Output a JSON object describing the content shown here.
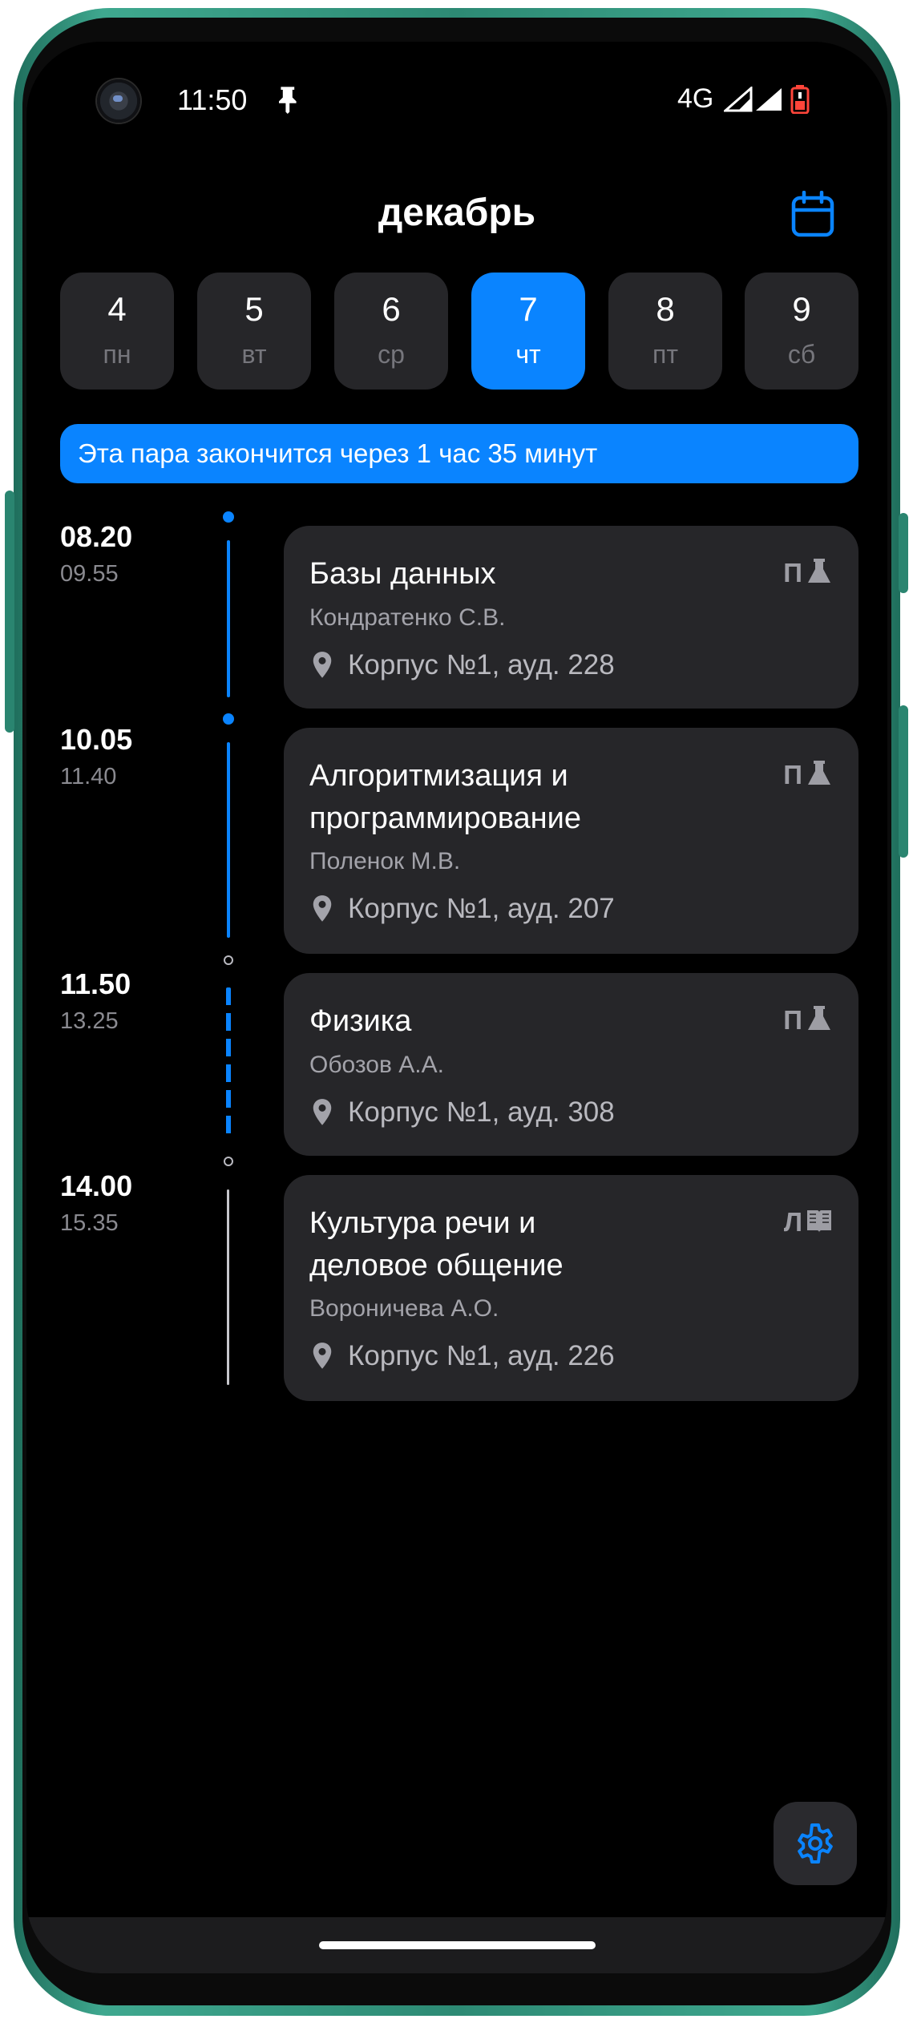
{
  "status_bar": {
    "time": "11:50",
    "network": "4G"
  },
  "header": {
    "month": "декабрь"
  },
  "days": [
    {
      "num": "4",
      "dow": "пн",
      "active": false
    },
    {
      "num": "5",
      "dow": "вт",
      "active": false
    },
    {
      "num": "6",
      "dow": "ср",
      "active": false
    },
    {
      "num": "7",
      "dow": "чт",
      "active": true
    },
    {
      "num": "8",
      "dow": "пт",
      "active": false
    },
    {
      "num": "9",
      "dow": "сб",
      "active": false
    }
  ],
  "banner": {
    "text": "Эта пара закончится через 1 час 35 минут"
  },
  "lessons": [
    {
      "start": "08.20",
      "end": "09.55",
      "title": "Базы данных",
      "teacher": "Кондратенко С.В.",
      "location": "Корпус №1, ауд. 228",
      "type": "П",
      "type_icon": "flask-icon"
    },
    {
      "start": "10.05",
      "end": "11.40",
      "title": "Алгоритмизация и программирование",
      "teacher": "Поленок М.В.",
      "location": "Корпус №1, ауд. 207",
      "type": "П",
      "type_icon": "flask-icon"
    },
    {
      "start": "11.50",
      "end": "13.25",
      "title": "Физика",
      "teacher": "Обозов А.А.",
      "location": "Корпус №1, ауд. 308",
      "type": "П",
      "type_icon": "flask-icon"
    },
    {
      "start": "14.00",
      "end": "15.35",
      "title": "Культура речи и деловое общение",
      "teacher": "Вороничева А.О.",
      "location": "Корпус №1, ауд. 226",
      "type": "Л",
      "type_icon": "book-icon"
    }
  ],
  "colors": {
    "accent": "#0a84ff",
    "card": "#262629",
    "background": "#000000"
  }
}
